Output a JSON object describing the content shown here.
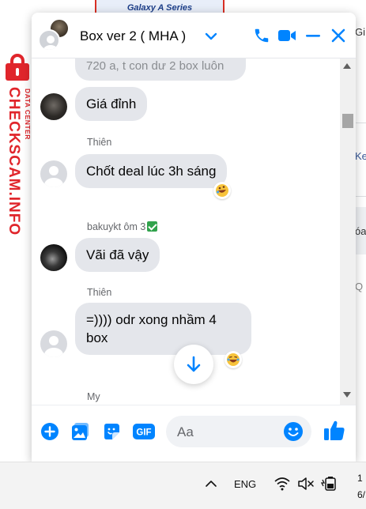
{
  "background": {
    "banner_text": "Galaxy A Series",
    "right_fragments": [
      "Gi",
      "Ke",
      "óa"
    ],
    "watermark": {
      "main": "CHECKSCAM.INFO",
      "sub": "DATA CENTER"
    }
  },
  "chat": {
    "title": "Box ver 2 ( MHA )",
    "accent_color": "#0084ff",
    "header_buttons": [
      "phone-icon",
      "video-icon",
      "minimize-icon",
      "close-icon"
    ],
    "messages": [
      {
        "type": "cutoff",
        "text": "720 a, t con dư 2 box luôn"
      },
      {
        "sender": "",
        "text": "Giá đỉnh",
        "avatar": "dark-photo"
      },
      {
        "sender": "Thiên",
        "text": "Chốt deal lúc 3h sáng",
        "reaction": "rofl-emoji"
      },
      {
        "sender": "bakuykt ôm 3",
        "sender_badge": "green-check-icon",
        "text": "Vãi đã vậy",
        "avatar": "dark-photo-2"
      },
      {
        "sender": "Thiên",
        "lines": [
          "=)))) odr xong nhầm 4",
          "box"
        ],
        "reaction": "laughing-emoji"
      },
      {
        "sender": "My",
        "text": ""
      }
    ],
    "composer": {
      "placeholder": "Aa",
      "icons": [
        "plus-circle-icon",
        "photo-icon",
        "sticker-icon",
        "gif-icon",
        "emoji-icon",
        "thumbs-up-icon"
      ],
      "gif_label": "GIF"
    }
  },
  "taskbar": {
    "language": "ENG",
    "clock_line1": "1",
    "clock_line2": "6/"
  }
}
